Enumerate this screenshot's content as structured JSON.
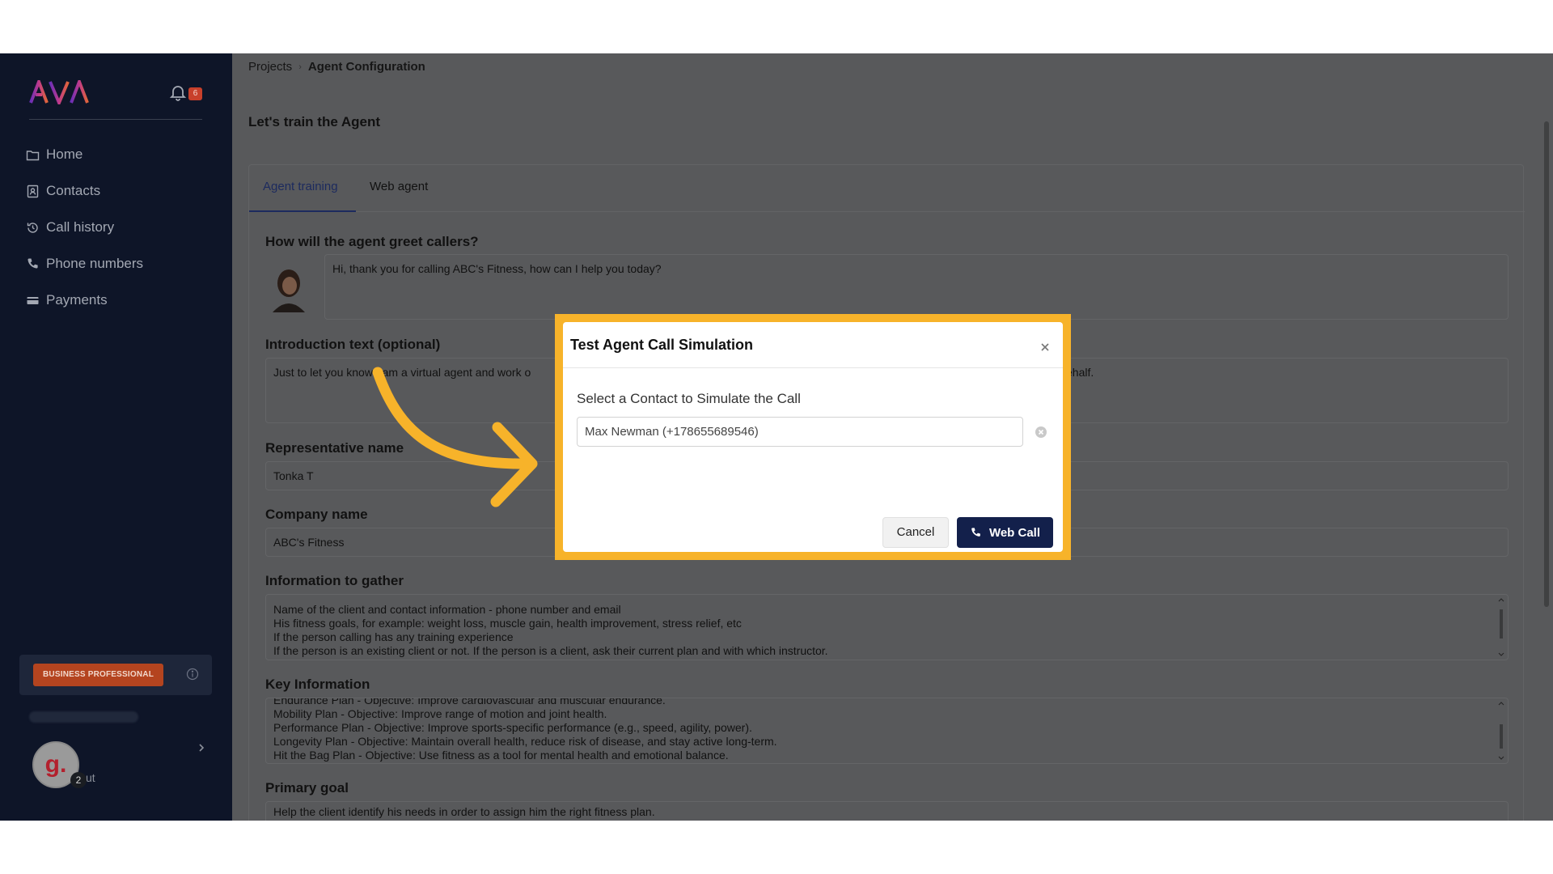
{
  "sidebar": {
    "logo_text": "AVA",
    "notification_count": "6",
    "nav": [
      {
        "label": "Home",
        "icon": "folder-icon"
      },
      {
        "label": "Contacts",
        "icon": "contact-book-icon"
      },
      {
        "label": "Call history",
        "icon": "history-icon"
      },
      {
        "label": "Phone numbers",
        "icon": "phone-icon"
      },
      {
        "label": "Payments",
        "icon": "card-icon"
      }
    ],
    "plan_badge": "BUSINESS PROFESSIONAL",
    "logout_partial": "ut",
    "avatar_letter": "g.",
    "avatar_count": "2"
  },
  "breadcrumb": {
    "parent": "Projects",
    "current": "Agent Configuration"
  },
  "page_title": "Let's train the Agent",
  "tabs": [
    {
      "label": "Agent training"
    },
    {
      "label": "Web agent"
    }
  ],
  "form": {
    "greet_label": "How will the agent greet callers?",
    "greet_value": "Hi, thank you for calling ABC's Fitness, how can I help you today?",
    "intro_label": "Introduction text (optional)",
    "intro_value_left": "Just to let you know I am a virtual agent and work o",
    "intro_value_right": "ehalf.",
    "rep_label": "Representative name",
    "rep_value": "Tonka T",
    "company_label": "Company name",
    "company_value": "ABC's Fitness",
    "info_label": "Information to gather",
    "info_lines": [
      "Name of the client and contact information - phone number and email",
      "His fitness goals, for example: weight loss, muscle gain, health improvement, stress relief, etc",
      "If the person calling has any training experience",
      "If the person is an existing client or not. If the person is a client, ask their current plan and with which instructor."
    ],
    "key_label": "Key Information",
    "key_lines": [
      "Endurance Plan - Objective: Improve cardiovascular and muscular endurance.",
      "Mobility Plan - Objective: Improve range of motion and joint health.",
      "Performance Plan - Objective: Improve sports-specific performance (e.g., speed, agility, power).",
      "Longevity Plan - Objective: Maintain overall health, reduce risk of disease, and stay active long-term.",
      "Hit the Bag Plan - Objective: Use fitness as a tool for mental health and emotional balance."
    ],
    "goal_label": "Primary goal",
    "goal_value": "Help the client identify his needs in order to assign him the right fitness plan."
  },
  "modal": {
    "title": "Test Agent Call Simulation",
    "subtitle": "Select a Contact to Simulate the Call",
    "selected_contact": "Max Newman (+178655689546)",
    "cancel_label": "Cancel",
    "call_label": "Web Call"
  },
  "colors": {
    "sidebar_bg": "#0e1528",
    "overlay_bg": "#58595b",
    "highlight": "#f7b32a",
    "primary_button": "#13204b",
    "plan_badge": "#b4441f"
  }
}
